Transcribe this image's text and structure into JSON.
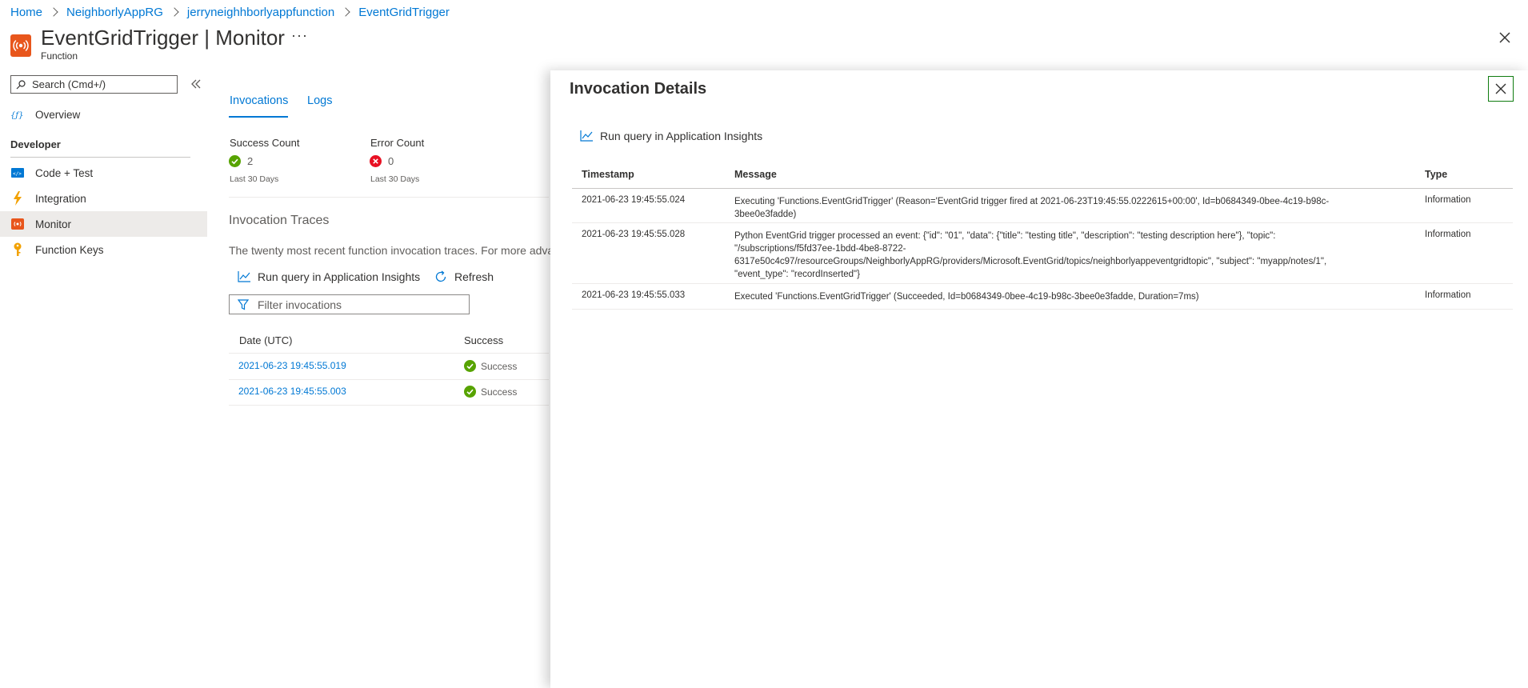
{
  "breadcrumb": [
    "Home",
    "NeighborlyAppRG",
    "jerryneighhborlyappfunction",
    "EventGridTrigger"
  ],
  "header": {
    "title_name": "EventGridTrigger",
    "title_separator": "|",
    "title_section": "Monitor",
    "subtitle": "Function",
    "more": "···"
  },
  "search": {
    "placeholder": "Search (Cmd+/)"
  },
  "menu": {
    "overview": "Overview",
    "section_developer": "Developer",
    "items": [
      {
        "label": "Code + Test",
        "icon": "code-icon"
      },
      {
        "label": "Integration",
        "icon": "lightning-icon"
      },
      {
        "label": "Monitor",
        "icon": "monitor-icon",
        "active": true
      },
      {
        "label": "Function Keys",
        "icon": "key-icon"
      }
    ]
  },
  "tabs": {
    "invocations": "Invocations",
    "logs": "Logs"
  },
  "stats": {
    "success_label": "Success Count",
    "success_value": "2",
    "error_label": "Error Count",
    "error_value": "0",
    "period": "Last 30 Days"
  },
  "traces": {
    "title": "Invocation Traces",
    "description": "The twenty most recent function invocation traces. For more adva",
    "run_query": "Run query in Application Insights",
    "refresh": "Refresh",
    "filter_placeholder": "Filter invocations",
    "columns": {
      "date": "Date (UTC)",
      "success": "Success"
    },
    "rows": [
      {
        "date": "2021-06-23 19:45:55.019",
        "status": "Success"
      },
      {
        "date": "2021-06-23 19:45:55.003",
        "status": "Success"
      }
    ]
  },
  "details": {
    "title": "Invocation Details",
    "run_query": "Run query in Application Insights",
    "columns": {
      "timestamp": "Timestamp",
      "message": "Message",
      "type": "Type"
    },
    "rows": [
      {
        "timestamp": "2021-06-23 19:45:55.024",
        "message": "Executing 'Functions.EventGridTrigger' (Reason='EventGrid trigger fired at 2021-06-23T19:45:55.0222615+00:00', Id=b0684349-0bee-4c19-b98c-3bee0e3fadde)",
        "type": "Information"
      },
      {
        "timestamp": "2021-06-23 19:45:55.028",
        "message": "Python EventGrid trigger processed an event: {\"id\": \"01\", \"data\": {\"title\": \"testing title\", \"description\": \"testing description here\"}, \"topic\": \"/subscriptions/f5fd37ee-1bdd-4be8-8722-6317e50c4c97/resourceGroups/NeighborlyAppRG/providers/Microsoft.EventGrid/topics/neighborlyappeventgridtopic\", \"subject\": \"myapp/notes/1\", \"event_type\": \"recordInserted\"}",
        "type": "Information"
      },
      {
        "timestamp": "2021-06-23 19:45:55.033",
        "message": "Executed 'Functions.EventGridTrigger' (Succeeded, Id=b0684349-0bee-4c19-b98c-3bee0e3fadde, Duration=7ms)",
        "type": "Information"
      }
    ]
  },
  "colors": {
    "accent": "#0078d4",
    "success": "#57a300",
    "error": "#e81123",
    "function_orange": "#e8561c"
  }
}
